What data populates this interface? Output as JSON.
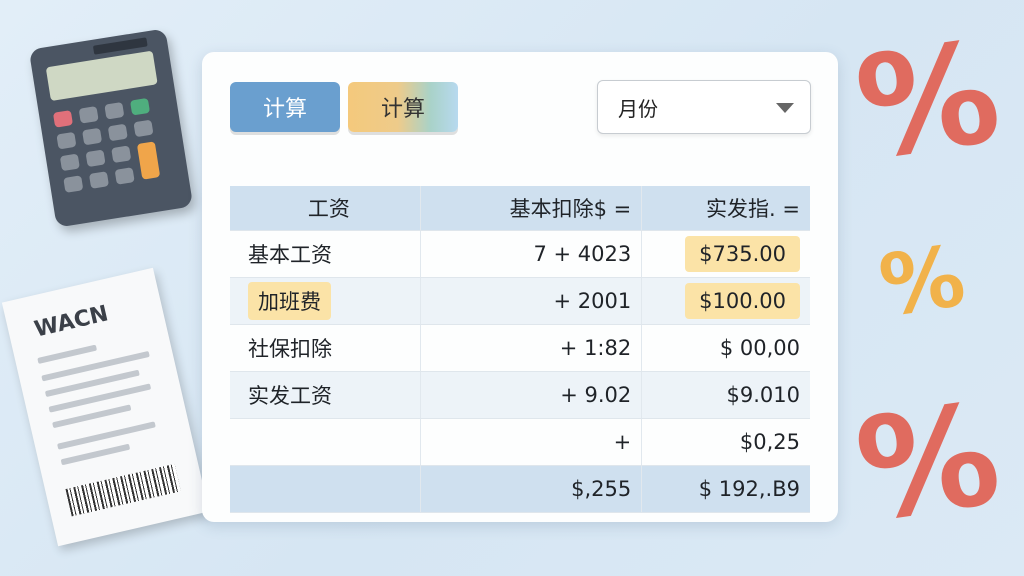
{
  "toolbar": {
    "calc_button_1": "计算",
    "calc_button_2": "计算"
  },
  "month_select": {
    "value": "月份"
  },
  "table": {
    "headers": [
      "工资",
      "基本扣除$ =",
      "实发指. ="
    ],
    "rows": [
      {
        "label": "基本工资",
        "deduction": "7 + 4023",
        "net": "$735.00",
        "label_highlight": false,
        "net_highlight": true
      },
      {
        "label": "加班费",
        "deduction": "+ 2001",
        "net": "$100.00",
        "label_highlight": true,
        "net_highlight": true
      },
      {
        "label": "社保扣除",
        "deduction": "+ 1:82",
        "net": "$ 00,00",
        "label_highlight": false,
        "net_highlight": false
      },
      {
        "label": "实发工资",
        "deduction": "+ 9.02",
        "net": "$9.010",
        "label_highlight": false,
        "net_highlight": false
      },
      {
        "label": "",
        "deduction": "+",
        "net": "$0,25",
        "label_highlight": false,
        "net_highlight": false
      }
    ],
    "total": {
      "label": "",
      "deduction": "$,255",
      "net": "$ 192,.B9"
    }
  },
  "decor": {
    "receipt_title": "WACN",
    "percent_symbol": "%",
    "icons": [
      "calculator-icon",
      "receipt-icon",
      "percent-icon"
    ]
  },
  "colors": {
    "background": "#d9e8f4",
    "primary_button": "#6a9fcf",
    "highlight": "#fbe3a7",
    "table_header": "#cfe0ef",
    "percent_red": "#e06b5f",
    "percent_yellow": "#f1b24a"
  }
}
